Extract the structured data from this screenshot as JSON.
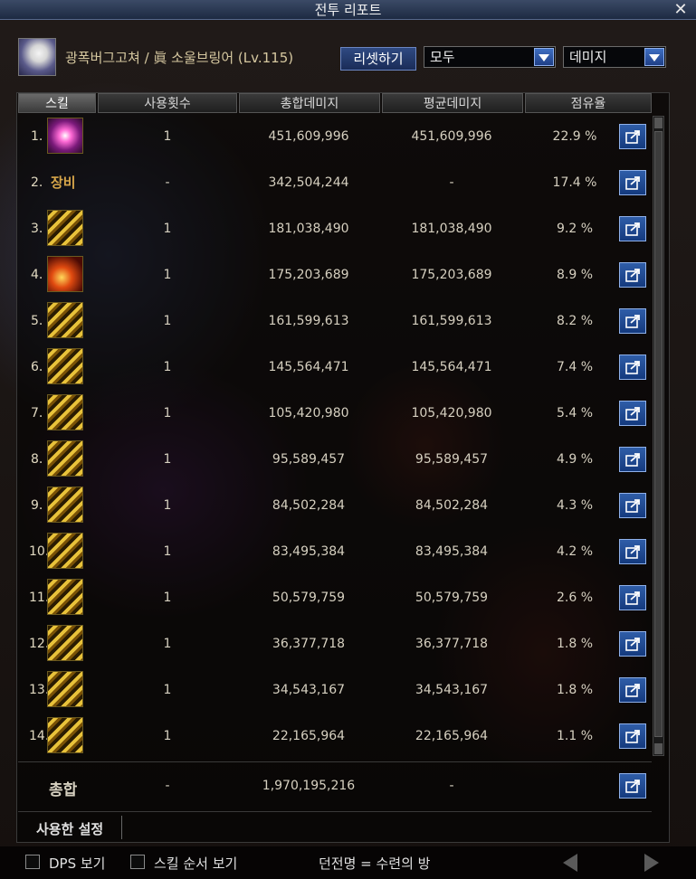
{
  "window": {
    "title": "전투 리포트",
    "close": "✕"
  },
  "header": {
    "character": "광폭버그고쳐 / 眞 소울브링어 (Lv.115)",
    "reset_label": "리셋하기",
    "filter_value": "모두",
    "metric_value": "데미지"
  },
  "columns": [
    "스킬",
    "사용횟수",
    "총합데미지",
    "평균데미지",
    "점유율"
  ],
  "rows": [
    {
      "rank": "1.",
      "icon": "pink-burst-skill-icon",
      "count": "1",
      "total": "451,609,996",
      "avg": "451,609,996",
      "share": "22.9 %"
    },
    {
      "rank": "2.",
      "label": "장비",
      "count": "-",
      "total": "342,504,244",
      "avg": "-",
      "share": "17.4 %"
    },
    {
      "rank": "3.",
      "icon": "gold-slash-skill-icon",
      "count": "1",
      "total": "181,038,490",
      "avg": "181,038,490",
      "share": "9.2 %"
    },
    {
      "rank": "4.",
      "icon": "fire-skill-icon",
      "count": "1",
      "total": "175,203,689",
      "avg": "175,203,689",
      "share": "8.9 %"
    },
    {
      "rank": "5.",
      "icon": "gold-cross-skill-icon",
      "count": "1",
      "total": "161,599,613",
      "avg": "161,599,613",
      "share": "8.2 %"
    },
    {
      "rank": "6.",
      "icon": "gold-dragon-skill-icon",
      "count": "1",
      "total": "145,564,471",
      "avg": "145,564,471",
      "share": "7.4 %"
    },
    {
      "rank": "7.",
      "icon": "gold-wave-skill-icon",
      "count": "1",
      "total": "105,420,980",
      "avg": "105,420,980",
      "share": "5.4 %"
    },
    {
      "rank": "8.",
      "icon": "gold-fist-skill-icon",
      "count": "1",
      "total": "95,589,457",
      "avg": "95,589,457",
      "share": "4.9 %"
    },
    {
      "rank": "9.",
      "icon": "gold-orb-skill-icon",
      "count": "1",
      "total": "84,502,284",
      "avg": "84,502,284",
      "share": "4.3 %"
    },
    {
      "rank": "10.",
      "icon": "gold-diagonal-skill-icon",
      "count": "1",
      "total": "83,495,384",
      "avg": "83,495,384",
      "share": "4.2 %"
    },
    {
      "rank": "11.",
      "icon": "gold-spiral-skill-icon",
      "count": "1",
      "total": "50,579,759",
      "avg": "50,579,759",
      "share": "2.6 %"
    },
    {
      "rank": "12.",
      "icon": "gold-pillar-skill-icon",
      "count": "1",
      "total": "36,377,718",
      "avg": "36,377,718",
      "share": "1.8 %"
    },
    {
      "rank": "13.",
      "icon": "gold-arrow-skill-icon",
      "count": "1",
      "total": "34,543,167",
      "avg": "34,543,167",
      "share": "1.8 %"
    },
    {
      "rank": "14.",
      "icon": "gold-claw-skill-icon",
      "count": "1",
      "total": "22,165,964",
      "avg": "22,165,964",
      "share": "1.1 %"
    }
  ],
  "total": {
    "label": "총합",
    "count": "-",
    "total": "1,970,195,216",
    "avg": "-"
  },
  "used_settings_label": "사용한 설정",
  "footer": {
    "dps_label": "DPS 보기",
    "skill_order_label": "스킬 순서 보기",
    "dungeon": "던전명 = 수련의 방"
  },
  "colors": {
    "accent": "#2f5da8",
    "title": "#1d2a42",
    "gold": "#e8c23a"
  }
}
